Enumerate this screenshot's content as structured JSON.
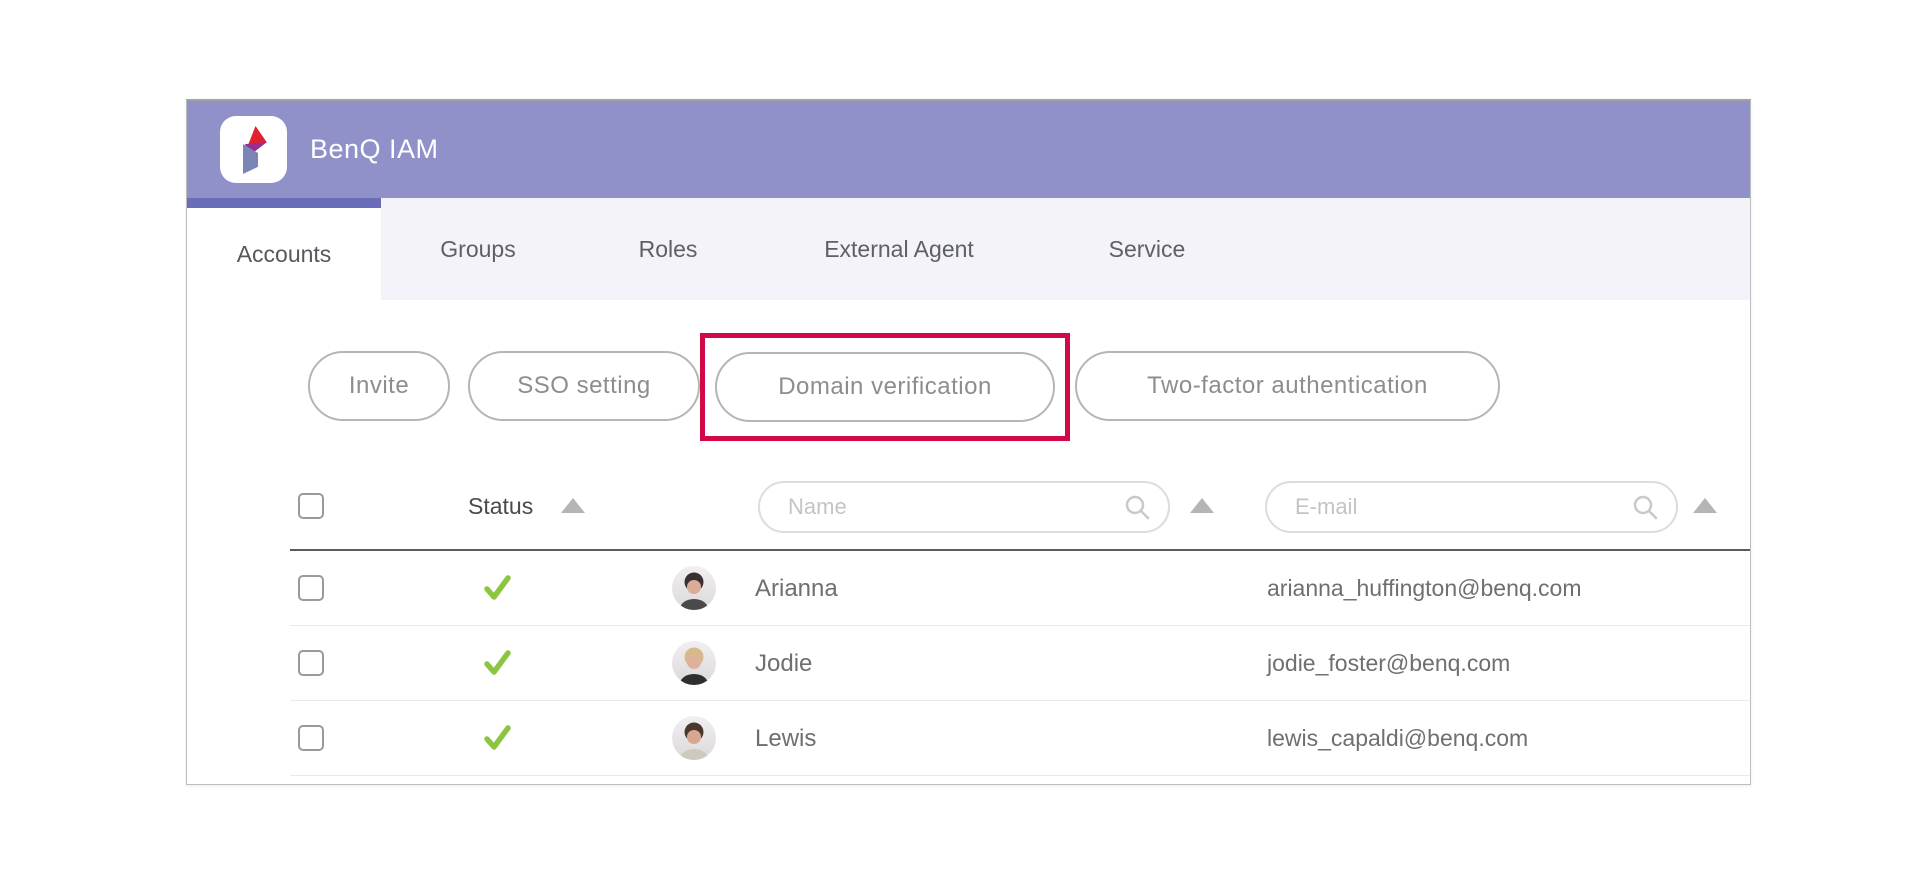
{
  "app": {
    "title": "BenQ IAM",
    "logo": "benq-iam-logo"
  },
  "tabs": [
    {
      "label": "Accounts",
      "active": true
    },
    {
      "label": "Groups",
      "active": false
    },
    {
      "label": "Roles",
      "active": false
    },
    {
      "label": "External Agent",
      "active": false
    },
    {
      "label": "Service",
      "active": false
    }
  ],
  "actions": {
    "invite_label": "Invite",
    "sso_label": "SSO setting",
    "domain_label": "Domain verification",
    "twofa_label": "Two-factor authentication",
    "highlighted_action": "Domain verification"
  },
  "table": {
    "status_header": "Status",
    "name_placeholder": "Name",
    "email_placeholder": "E-mail",
    "rows": [
      {
        "name": "Arianna",
        "email": "arianna_huffington@benq.com",
        "status": "verified",
        "avatar": {
          "hair": "#3a3033",
          "skin": "#d9ad96",
          "shirt": "#4a4a4a"
        }
      },
      {
        "name": "Jodie",
        "email": "jodie_foster@benq.com",
        "status": "verified",
        "avatar": {
          "hair": "#d8b98c",
          "skin": "#dcb29a",
          "shirt": "#2f2f2f"
        }
      },
      {
        "name": "Lewis",
        "email": "lewis_capaldi@benq.com",
        "status": "verified",
        "avatar": {
          "hair": "#4a382e",
          "skin": "#d6a98f",
          "shirt": "#cfc8bd"
        }
      }
    ]
  },
  "colors": {
    "header_purple": "#9091c9",
    "active_tab_indicator": "#6b6cb7",
    "tabbar_background": "#f3f3f9",
    "highlight_red": "#d10a47",
    "verified_green": "#8cc540",
    "pill_border": "#b5b5b5"
  }
}
